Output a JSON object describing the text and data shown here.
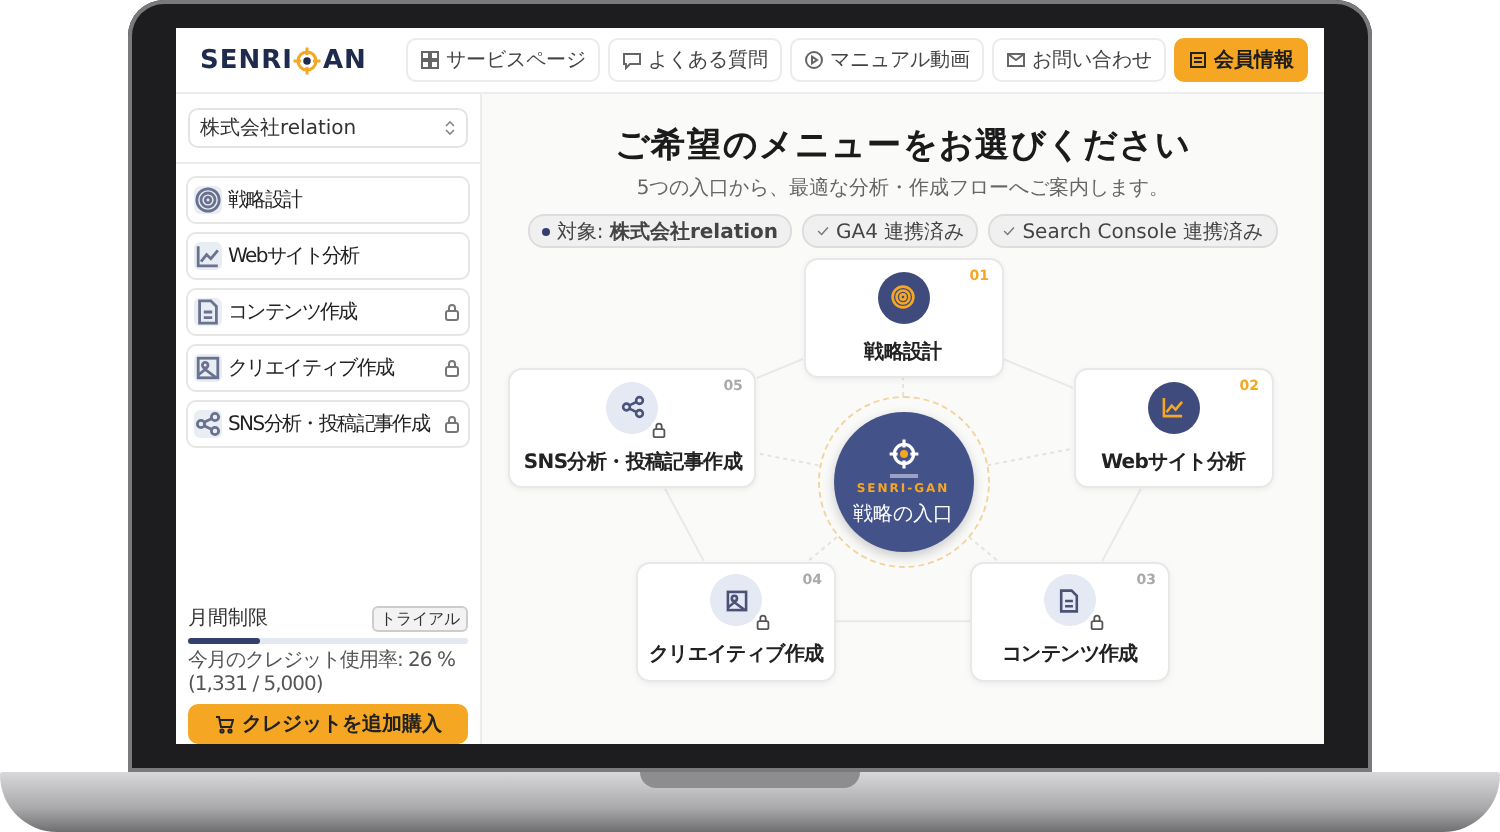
{
  "header": {
    "logo": {
      "left": "SENRI",
      "right": "AN"
    },
    "links": [
      {
        "label": "サービスページ",
        "kind": "grid",
        "primary": false
      },
      {
        "label": "よくある質問",
        "kind": "chat",
        "primary": false
      },
      {
        "label": "マニュアル動画",
        "kind": "play",
        "primary": false
      },
      {
        "label": "お問い合わせ",
        "kind": "mail",
        "primary": false
      },
      {
        "label": "会員情報",
        "kind": "card",
        "primary": true
      }
    ]
  },
  "sidebar": {
    "account": "株式会社relation",
    "items": [
      {
        "label": "戦略設計",
        "kind": "target",
        "locked": false
      },
      {
        "label": "Webサイト分析",
        "kind": "chart",
        "locked": false
      },
      {
        "label": "コンテンツ作成",
        "kind": "doc",
        "locked": true
      },
      {
        "label": "クリエイティブ作成",
        "kind": "image",
        "locked": true
      },
      {
        "label": "SNS分析・投稿記事作成",
        "kind": "share",
        "locked": true
      }
    ],
    "usage": {
      "label": "月間制限",
      "badge": "トライアル",
      "level": 0.26,
      "text": "今月のクレジット使用率: 26 % (1,331 / 5,000)",
      "button": "クレジットを追加購入"
    }
  },
  "main": {
    "title": "ご希望のメニューをお選びください",
    "subtitle": "5つの入口から、最適な分析・作成フローへご案内します。",
    "chips": [
      {
        "text": "対象: **株式会社relation**",
        "kind": "dot"
      },
      {
        "text": "GA4 連携済み",
        "kind": "check"
      },
      {
        "text": "Search Console 連携済み",
        "kind": "check"
      }
    ],
    "hub": {
      "brand": "SENRI-GAN",
      "label": "戦略の入口"
    },
    "nodes": [
      {
        "number": "01",
        "label": "戦略設計",
        "kind": "target",
        "locked": false
      },
      {
        "number": "05",
        "label": "SNS分析・投稿記事作成",
        "kind": "share",
        "locked": true
      },
      {
        "number": "02",
        "label": "Webサイト分析",
        "kind": "chart",
        "locked": false
      },
      {
        "number": "04",
        "label": "クリエイティブ作成",
        "kind": "image",
        "locked": true
      },
      {
        "number": "03",
        "label": "コンテンツ作成",
        "kind": "doc",
        "locked": true
      }
    ]
  }
}
